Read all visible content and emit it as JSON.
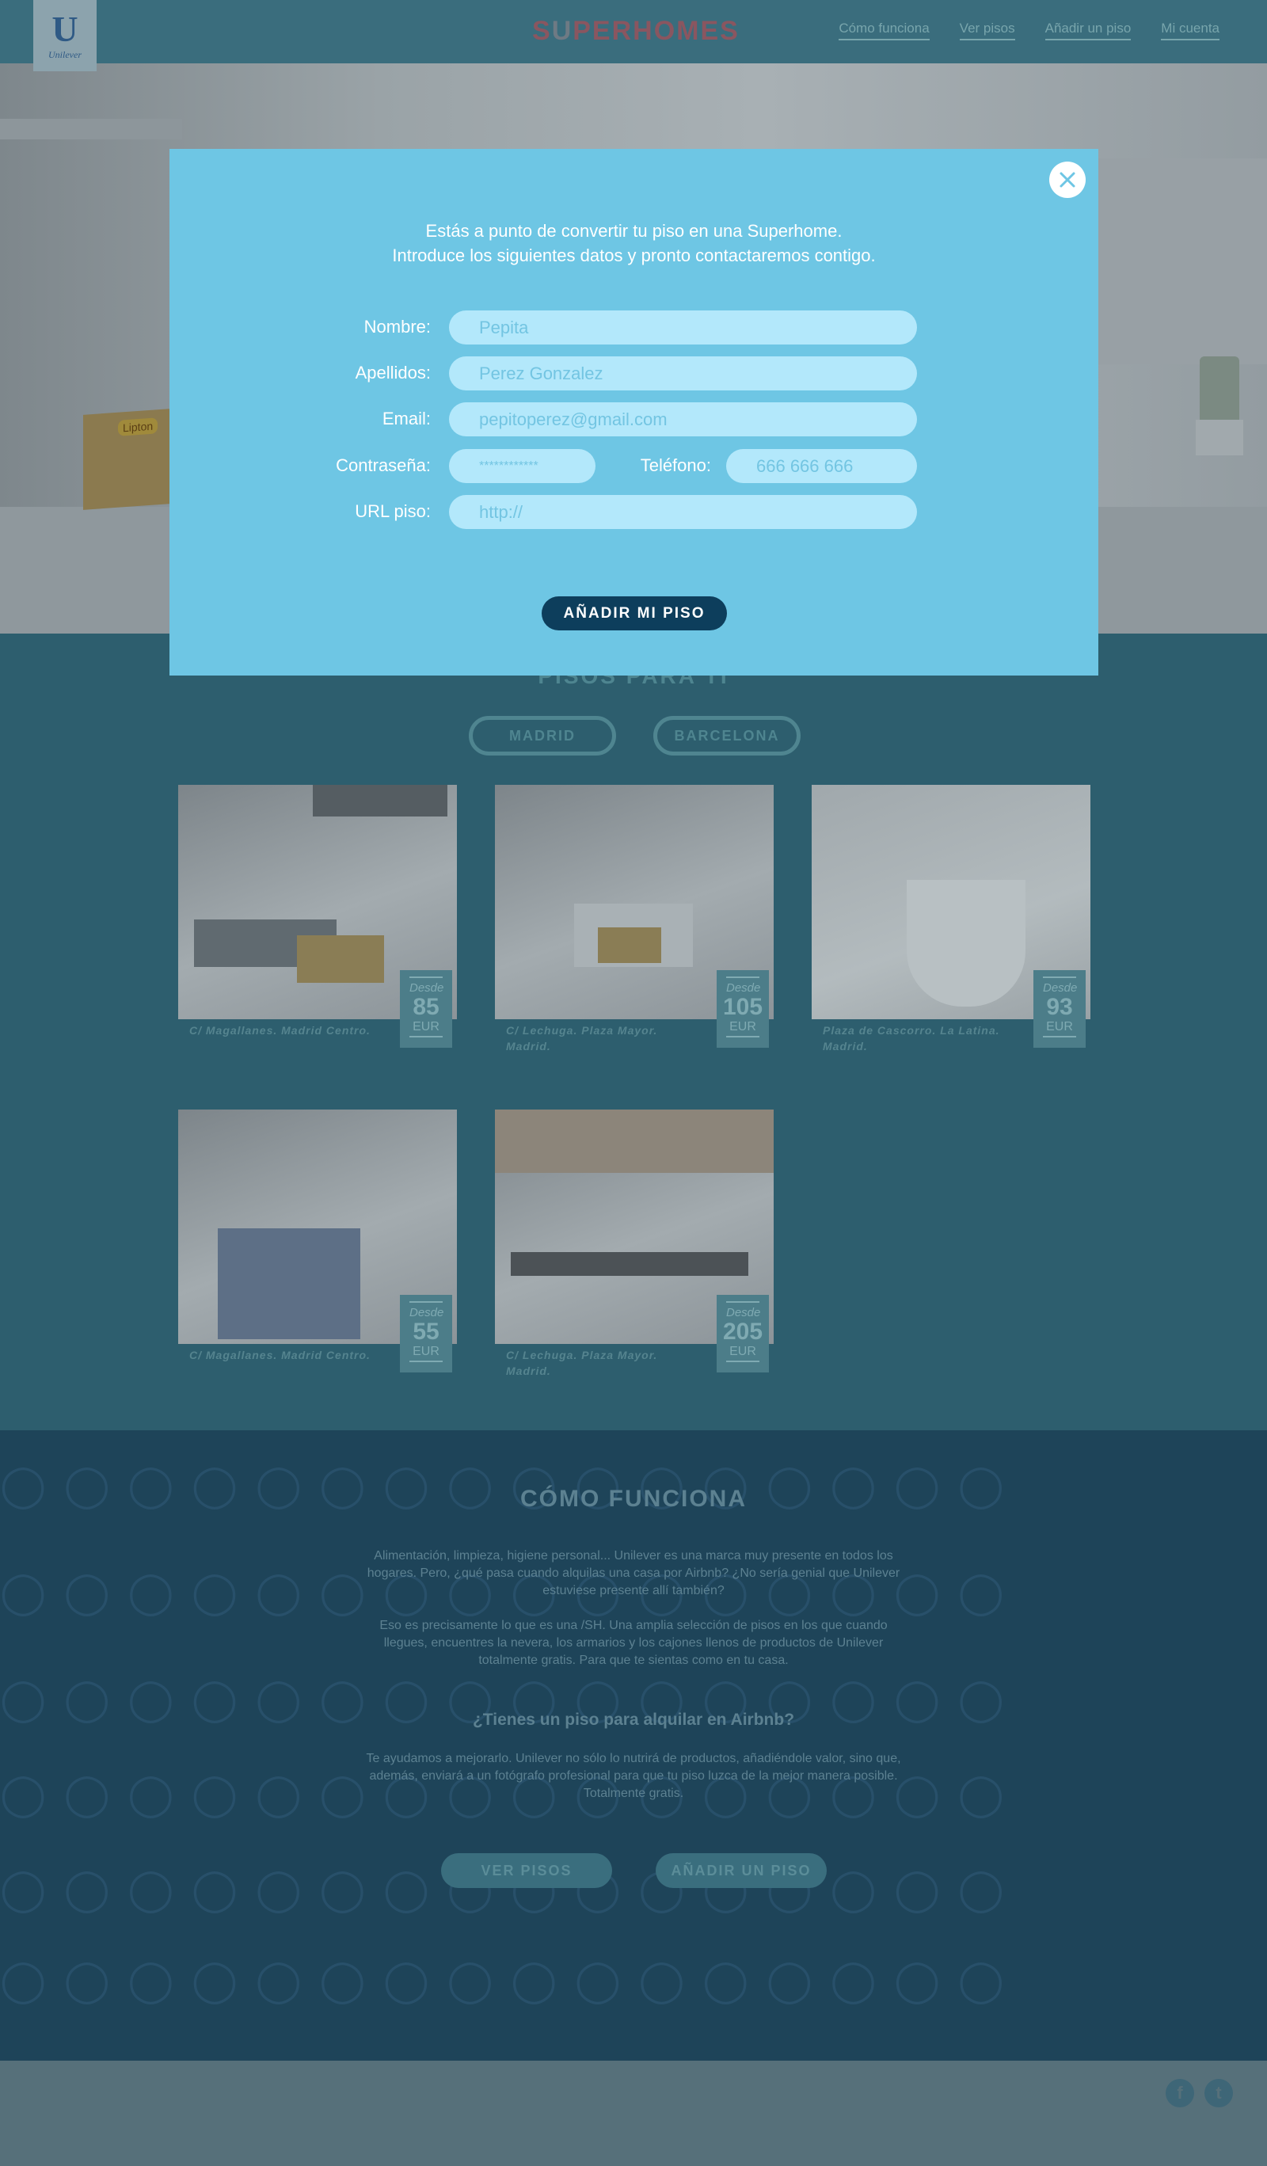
{
  "header": {
    "logo_letter": "U",
    "logo_word": "Unilever",
    "brand_pre": "S",
    "brand_a": "U",
    "brand_post": "PERHOMES",
    "nav": [
      "Cómo funciona",
      "Ver pisos",
      "Añadir un piso",
      "Mi cuenta"
    ]
  },
  "hero": {
    "box_label": "Lipton"
  },
  "modal": {
    "intro_line1": "Estás a punto de convertir tu piso en una Superhome.",
    "intro_line2": "Introduce los siguientes datos y pronto contactaremos contigo.",
    "fields": {
      "nombre": {
        "label": "Nombre:",
        "placeholder": "Pepita"
      },
      "apellidos": {
        "label": "Apellidos:",
        "placeholder": "Perez Gonzalez"
      },
      "email": {
        "label": "Email:",
        "placeholder": "pepitoperez@gmail.com"
      },
      "password": {
        "label": "Contraseña:",
        "placeholder": "************"
      },
      "telefono": {
        "label": "Teléfono:",
        "placeholder": "666 666 666"
      },
      "url": {
        "label": "URL piso:",
        "placeholder": "http://"
      }
    },
    "submit_label": "AÑADIR MI PISO"
  },
  "pisos": {
    "title": "PISOS PARA TI",
    "cities": [
      "MADRID",
      "BARCELONA"
    ],
    "cards": [
      {
        "address": "C/ Magallanes. Madrid Centro.",
        "desde": "Desde",
        "price": "85",
        "currency": "EUR"
      },
      {
        "address": "C/ Lechuga. Plaza Mayor. Madrid.",
        "desde": "Desde",
        "price": "105",
        "currency": "EUR"
      },
      {
        "address": "Plaza de Cascorro. La Latina. Madrid.",
        "desde": "Desde",
        "price": "93",
        "currency": "EUR"
      },
      {
        "address": "C/ Magallanes. Madrid Centro.",
        "desde": "Desde",
        "price": "55",
        "currency": "EUR"
      },
      {
        "address": "C/ Lechuga. Plaza Mayor. Madrid.",
        "desde": "Desde",
        "price": "205",
        "currency": "EUR"
      }
    ]
  },
  "como": {
    "title": "CÓMO FUNCIONA",
    "p1": "Alimentación, limpieza, higiene personal... Unilever es una marca muy presente en todos los hogares. Pero, ¿qué pasa cuando alquilas una casa por Airbnb? ¿No sería genial que Unilever estuviese presente allí también?",
    "p2": "Eso es precisamente lo que es una /SH. Una amplia selección de pisos en los que cuando llegues, encuentres la nevera, los armarios y los cajones llenos de productos de Unilever totalmente gratis. Para que te sientas como en tu casa.",
    "subtitle": "¿Tienes un piso para alquilar en Airbnb?",
    "p3": "Te ayudamos a mejorarlo. Unilever no sólo lo nutrirá de productos, añadiéndole valor, sino que, además, enviará a un fotógrafo profesional para que tu piso luzca de la mejor manera posible. Totalmente gratis.",
    "btn_ver": "VER PISOS",
    "btn_anadir": "AÑADIR UN PISO"
  },
  "footer": {
    "facebook": "f",
    "twitter": "t"
  }
}
